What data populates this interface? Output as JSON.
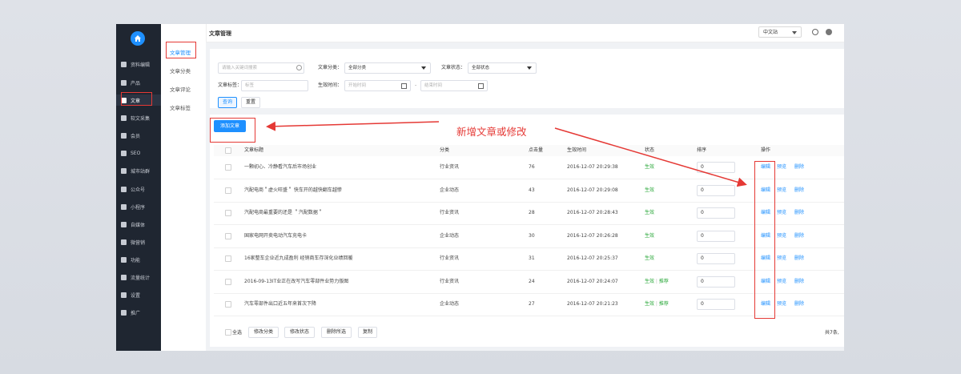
{
  "nav": {
    "items": [
      {
        "label": "资料编辑",
        "icon": "bars-icon"
      },
      {
        "label": "产品",
        "icon": "grid-icon"
      },
      {
        "label": "文章",
        "icon": "document-icon"
      },
      {
        "label": "软文采集",
        "icon": "document-icon"
      },
      {
        "label": "会员",
        "icon": "user-icon"
      },
      {
        "label": "SEO",
        "icon": "document-icon"
      },
      {
        "label": "城市站群",
        "icon": "document-icon"
      },
      {
        "label": "公众号",
        "icon": "chat-icon"
      },
      {
        "label": "小程序",
        "icon": "miniapp-icon"
      },
      {
        "label": "自媒体",
        "icon": "media-icon"
      },
      {
        "label": "微营销",
        "icon": "grid-icon"
      },
      {
        "label": "功能",
        "icon": "wrench-icon"
      },
      {
        "label": "流量统计",
        "icon": "chart-icon"
      },
      {
        "label": "设置",
        "icon": "gear-icon"
      },
      {
        "label": "推广",
        "icon": "chart-icon"
      }
    ]
  },
  "sub_nav": {
    "items": [
      "文章管理",
      "文章分类",
      "文章评论",
      "文章标签"
    ]
  },
  "header": {
    "title": "文章管理",
    "site_select": "中文站"
  },
  "filter": {
    "keyword_placeholder": "请输入关键词搜索",
    "category_label": "文章分类：",
    "category_value": "全部分类",
    "status_label": "文章状态：",
    "status_value": "全部状态",
    "tag_label": "文章标签：",
    "tag_placeholder": "标签",
    "time_label": "生效时间：",
    "start_placeholder": "开始时间",
    "range_sep": "-",
    "end_placeholder": "结束时间",
    "query_btn": "查询",
    "reset_btn": "重置"
  },
  "add_button": "添加文章",
  "annotation": "新增文章或修改",
  "table": {
    "headers": {
      "title": "文章标题",
      "category": "分类",
      "views": "点击量",
      "time": "生效时间",
      "status": "状态",
      "sort": "排序",
      "actions": "操作"
    },
    "rows": [
      {
        "title": "一颗初心、冷静看汽车后市场创业",
        "category": "行业资讯",
        "views": "76",
        "time": "2016-12-07 20:29:38",
        "status": "生效",
        "recommend": "",
        "sort": "0"
      },
      {
        "title": "汽配电商＂虚火旺盛＂ 快车开的越快翻车越惨",
        "category": "企业动态",
        "views": "43",
        "time": "2016-12-07 20:29:08",
        "status": "生效",
        "recommend": "",
        "sort": "0"
      },
      {
        "title": "汽配电商最重要的还是 ＂汽配数据＂",
        "category": "行业资讯",
        "views": "28",
        "time": "2016-12-07 20:28:43",
        "status": "生效",
        "recommend": "",
        "sort": "0"
      },
      {
        "title": "国家电网开卖电动汽车充电卡",
        "category": "企业动态",
        "views": "30",
        "time": "2016-12-07 20:26:28",
        "status": "生效",
        "recommend": "",
        "sort": "0"
      },
      {
        "title": "16家整车企业近九成盈利 经销商车存深化业绩回暖",
        "category": "行业资讯",
        "views": "31",
        "time": "2016-12-07 20:25:37",
        "status": "生效",
        "recommend": "",
        "sort": "0"
      },
      {
        "title": "2016-09-13IT业正在改写汽车零部件业势力版图",
        "category": "行业资讯",
        "views": "24",
        "time": "2016-12-07 20:24:07",
        "status": "生效",
        "recommend": "推荐",
        "sort": "0"
      },
      {
        "title": "汽车零部件出口近五年来首次下降",
        "category": "企业动态",
        "views": "27",
        "time": "2016-12-07 20:21:23",
        "status": "生效",
        "recommend": "推荐",
        "sort": "0"
      }
    ],
    "actions": {
      "edit": "编辑",
      "preview": "预览",
      "delete": "删除"
    }
  },
  "footer": {
    "select_all": "全选",
    "buttons": [
      "修改分类",
      "修改状态",
      "删除所选",
      "复制"
    ],
    "total": "共7条,"
  }
}
